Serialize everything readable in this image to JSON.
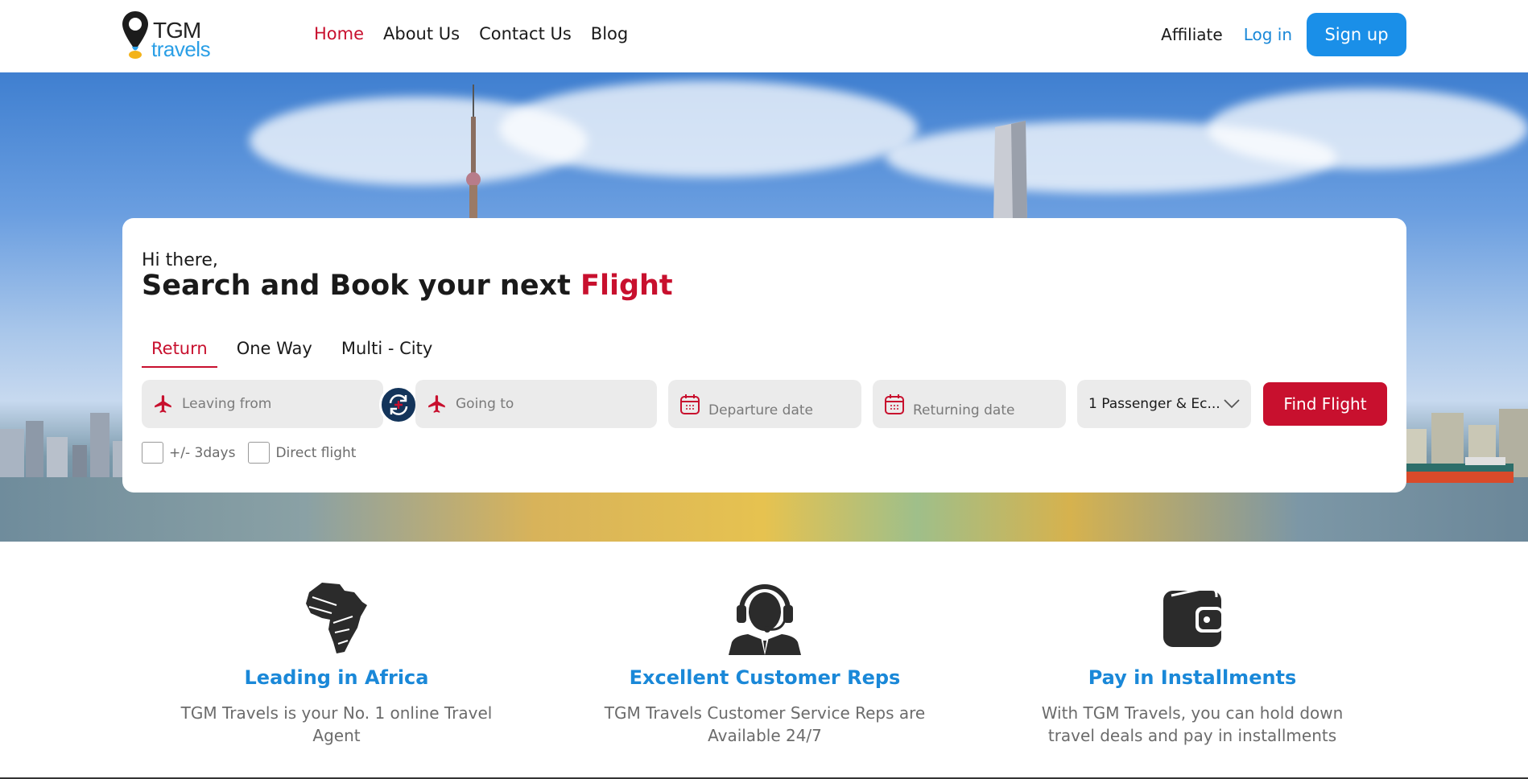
{
  "header": {
    "logo_top": "TGM",
    "logo_bottom": "travels",
    "nav": [
      {
        "label": "Home",
        "active": true
      },
      {
        "label": "About Us",
        "active": false
      },
      {
        "label": "Contact Us",
        "active": false
      },
      {
        "label": "Blog",
        "active": false
      }
    ],
    "affiliate_label": "Affiliate",
    "login_label": "Log in",
    "signup_label": "Sign up"
  },
  "search": {
    "greeting": "Hi there,",
    "headline_prefix": "Search and Book your next ",
    "headline_accent": "Flight",
    "tabs": [
      {
        "label": "Return",
        "active": true
      },
      {
        "label": "One Way",
        "active": false
      },
      {
        "label": "Multi - City",
        "active": false
      }
    ],
    "from_placeholder": "Leaving from",
    "to_placeholder": "Going to",
    "departure_placeholder": "Departure date",
    "return_placeholder": "Returning date",
    "passengers_value": "1 Passenger & Ec...",
    "find_label": "Find Flight",
    "check_flex": "+/- 3days",
    "check_direct": "Direct flight"
  },
  "features": [
    {
      "icon": "africa-map-icon",
      "title": "Leading in Africa",
      "text": "TGM Travels is your No. 1 online Travel Agent"
    },
    {
      "icon": "customer-rep-icon",
      "title": "Excellent Customer Reps",
      "text": "TGM Travels Customer Service Reps are Available 24/7"
    },
    {
      "icon": "wallet-icon",
      "title": "Pay in Installments",
      "text": "With TGM Travels, you can hold down travel deals and pay in installments"
    }
  ],
  "colors": {
    "brand_red": "#c8102e",
    "brand_blue": "#1a8fe8",
    "navy": "#13345a"
  }
}
